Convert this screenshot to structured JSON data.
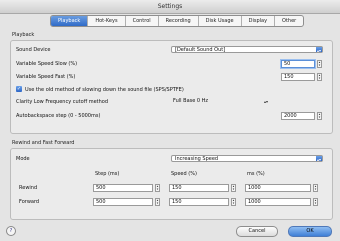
{
  "window": {
    "title": "Settings"
  },
  "tabs": [
    {
      "label": "Playback",
      "active": true
    },
    {
      "label": "Hot-Keys"
    },
    {
      "label": "Control"
    },
    {
      "label": "Recording"
    },
    {
      "label": "Disk Usage"
    },
    {
      "label": "Display"
    },
    {
      "label": "Other"
    }
  ],
  "playback": {
    "group_title": "Playback",
    "sound_device_label": "Sound Device",
    "sound_device_value": "[Default Sound Out]",
    "var_slow_label": "Variable Speed Slow (%)",
    "var_slow_value": "50",
    "var_fast_label": "Variable Speed Fast (%)",
    "var_fast_value": "150",
    "sps_checked": true,
    "sps_label": "Use the old method of slowing down the sound file (SPS/SPTFE)",
    "clarity_label": "Clarity Low Frequency cutoff method",
    "clarity_value": "Full Base 0 Hz",
    "autobackspace_label": "Autobackspace step (0 - 5000ms)",
    "autobackspace_value": "2000"
  },
  "rewind": {
    "group_title": "Rewind and Fast Forward",
    "mode_label": "Mode",
    "mode_value": "Increasing Speed",
    "col_step": "Step (ms)",
    "col_speed": "Speed (%)",
    "col_ms": "ms (%)",
    "rows": [
      {
        "label": "Rewind",
        "step": "500",
        "speed": "150",
        "ms": "1000"
      },
      {
        "label": "Forward",
        "step": "500",
        "speed": "150",
        "ms": "1000"
      }
    ]
  },
  "footer": {
    "help": "?",
    "cancel": "Cancel",
    "ok": "OK"
  }
}
